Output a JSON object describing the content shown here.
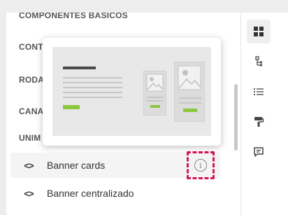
{
  "categories": {
    "top": "COMPONENTES BASICOS",
    "cont": "CONT",
    "roda": "RODA",
    "cana": "CANA",
    "unim": "UNIM"
  },
  "items": [
    {
      "code": "<>",
      "label": "Banner cards"
    },
    {
      "code": "<>",
      "label": "Banner centralizado"
    }
  ],
  "info_glyph": "i",
  "toolbar_icons": [
    "grid-icon",
    "tree-icon",
    "list-icon",
    "paint-roller-icon",
    "comment-icon"
  ],
  "colors": {
    "highlight_dashed": "#d4144f",
    "preview_accent": "#8dc63f",
    "preview_bg": "#e8e8e8"
  }
}
